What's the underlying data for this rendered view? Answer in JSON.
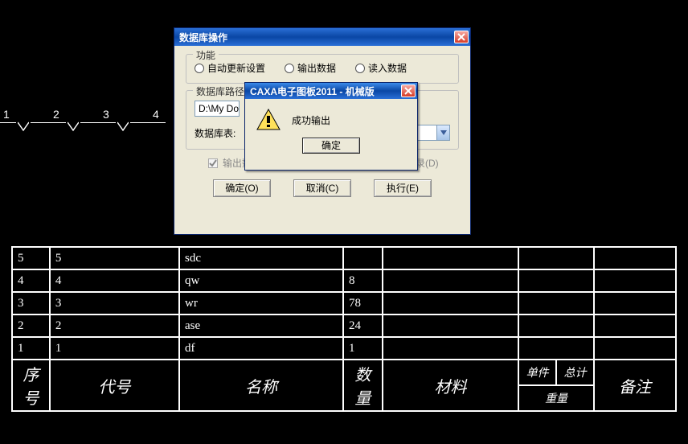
{
  "dims": [
    "1",
    "2",
    "3",
    "4"
  ],
  "dialog": {
    "title": "数据库操作",
    "group_function": "功能",
    "radio_auto": "自动更新设置",
    "radio_export": "输出数据",
    "radio_import": "读入数据",
    "group_path": "数据库路径",
    "path_value": "D:\\My Do",
    "browse": "...",
    "table_label": "数据库表:",
    "checkbox_label": "输出数据时自动删除指定数据库表中的所有记录(D)",
    "ok": "确定(O)",
    "cancel": "取消(C)",
    "execute": "执行(E)"
  },
  "alert": {
    "title": "CAXA电子图板2011 - 机械版",
    "message": "成功输出",
    "ok": "确定"
  },
  "table": {
    "rows": [
      {
        "n": "5",
        "code": "5",
        "name": "sdc",
        "qty": "",
        "mat": "",
        "unit": "",
        "total": "",
        "note": ""
      },
      {
        "n": "4",
        "code": "4",
        "name": "qw",
        "qty": "8",
        "mat": "",
        "unit": "",
        "total": "",
        "note": ""
      },
      {
        "n": "3",
        "code": "3",
        "name": "wr",
        "qty": "78",
        "mat": "",
        "unit": "",
        "total": "",
        "note": ""
      },
      {
        "n": "2",
        "code": "2",
        "name": "ase",
        "qty": "24",
        "mat": "",
        "unit": "",
        "total": "",
        "note": ""
      },
      {
        "n": "1",
        "code": "1",
        "name": "df",
        "qty": "1",
        "mat": "",
        "unit": "",
        "total": "",
        "note": ""
      }
    ],
    "hdr": {
      "seq": "序号",
      "code": "代号",
      "name": "名称",
      "qty": "数量",
      "mat": "材料",
      "unit": "单件",
      "total": "总计",
      "weight": "重量",
      "note": "备注"
    }
  }
}
